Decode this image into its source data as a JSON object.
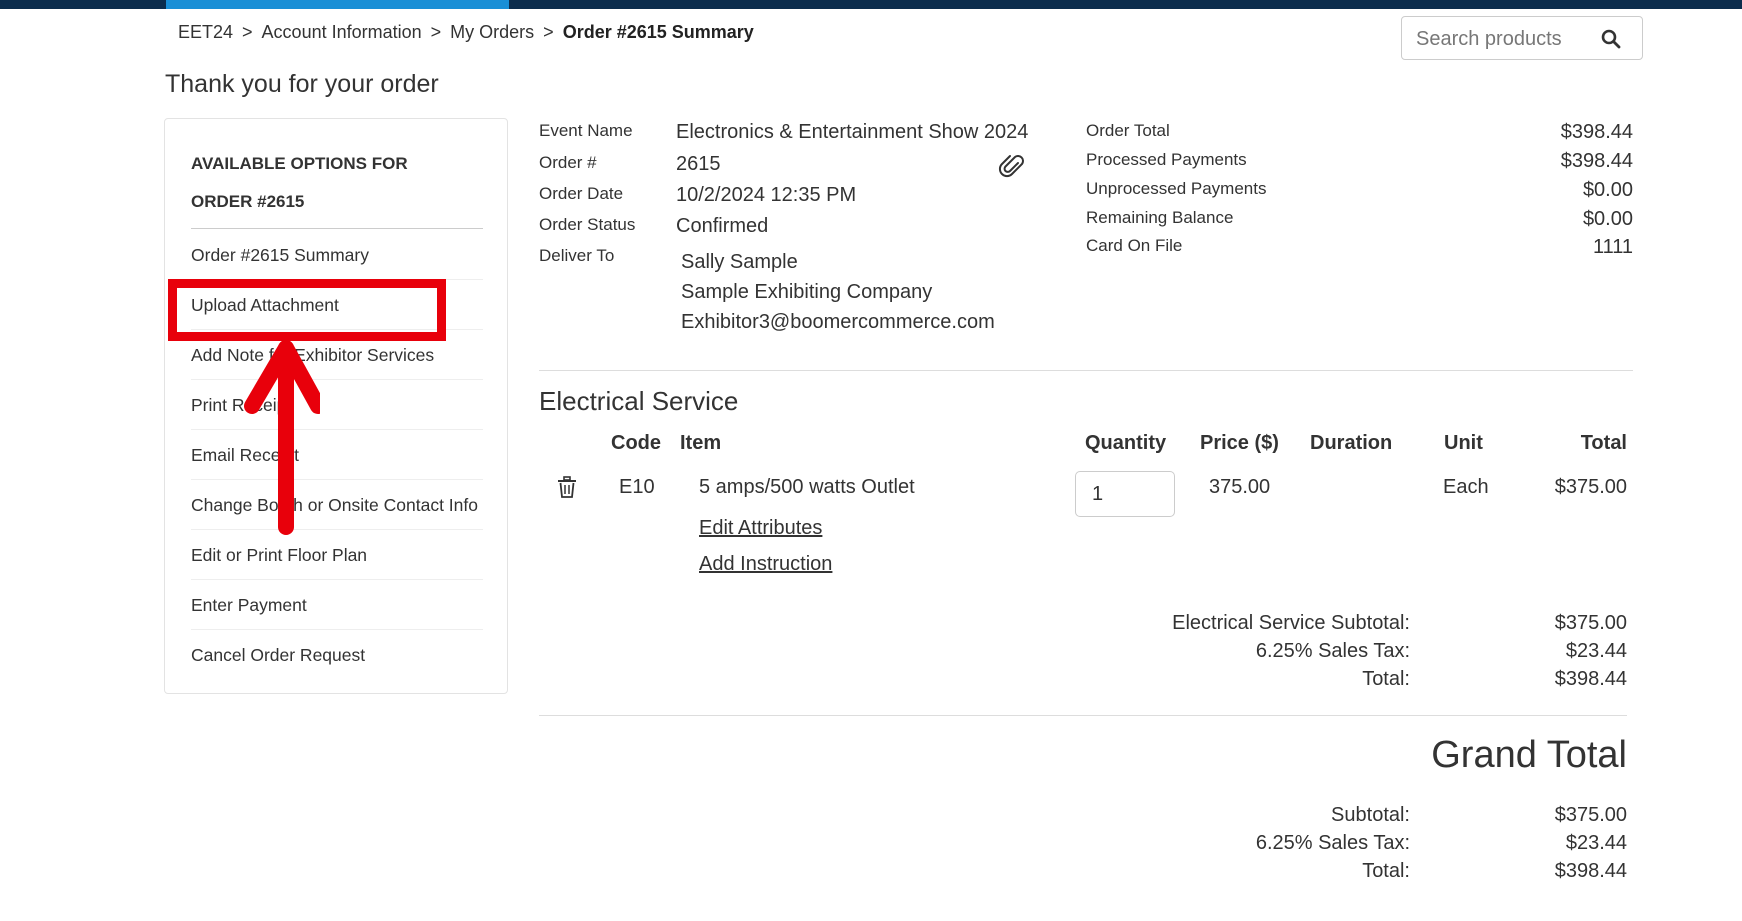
{
  "breadcrumb": {
    "items": [
      "EET24",
      "Account Information",
      "My Orders"
    ],
    "separator": ">",
    "current": "Order #2615 Summary"
  },
  "search": {
    "placeholder": "Search products",
    "icon": "search-icon"
  },
  "page_title": "Thank you for your order",
  "sidebar": {
    "heading": "AVAILABLE OPTIONS FOR ORDER #2615",
    "items": [
      "Order #2615 Summary",
      "Upload Attachment",
      "Add Note for Exhibitor Services",
      "Print Receipt",
      "Email Receipt",
      "Change Booth or Onsite Contact Info",
      "Edit or Print Floor Plan",
      "Enter Payment",
      "Cancel Order Request"
    ]
  },
  "order_info": {
    "event_name_label": "Event Name",
    "event_name": "Electronics & Entertainment Show 2024",
    "order_no_label": "Order #",
    "order_no": "2615",
    "order_date_label": "Order Date",
    "order_date": "10/2/2024 12:35 PM",
    "order_status_label": "Order Status",
    "order_status": "Confirmed",
    "deliver_to_label": "Deliver To",
    "deliver_name": "Sally Sample",
    "deliver_company": "Sample Exhibiting Company",
    "deliver_email": "Exhibitor3@boomercommerce.com"
  },
  "payment_summary": {
    "rows": [
      {
        "label": "Order Total",
        "value": "$398.44"
      },
      {
        "label": "Processed Payments",
        "value": "$398.44"
      },
      {
        "label": "Unprocessed Payments",
        "value": "$0.00"
      },
      {
        "label": "Remaining Balance",
        "value": "$0.00"
      },
      {
        "label": "Card On File",
        "value": "1111"
      }
    ]
  },
  "section": {
    "title": "Electrical Service",
    "columns": {
      "code": "Code",
      "item": "Item",
      "quantity": "Quantity",
      "price": "Price ($)",
      "duration": "Duration",
      "unit": "Unit",
      "total": "Total"
    },
    "row": {
      "code": "E10",
      "item": "5 amps/500 watts Outlet",
      "quantity": "1",
      "price": "375.00",
      "duration": "",
      "unit": "Each",
      "total": "$375.00",
      "edit_link": "Edit Attributes",
      "instruction_link": "Add Instruction"
    },
    "subtotal_label": "Electrical Service Subtotal:",
    "subtotal": "$375.00",
    "tax_label": "6.25% Sales Tax:",
    "tax": "$23.44",
    "total_label": "Total:",
    "total": "$398.44"
  },
  "grand_total": {
    "title": "Grand Total",
    "subtotal_label": "Subtotal:",
    "subtotal": "$375.00",
    "tax_label": "6.25% Sales Tax:",
    "tax": "$23.44",
    "total_label": "Total:",
    "total": "$398.44"
  },
  "colors": {
    "top_bar": "#0c2d4d",
    "top_bar_accent": "#1a8fd6",
    "annotation": "#e8000b"
  }
}
